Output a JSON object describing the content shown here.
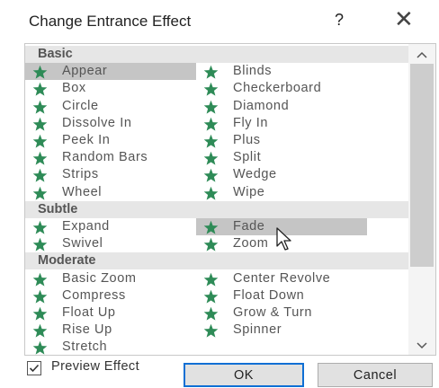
{
  "window": {
    "title": "Change Entrance Effect",
    "help_label": "?",
    "close_label": "✕"
  },
  "effects": {
    "sections": [
      {
        "name": "Basic",
        "items": [
          {
            "label": "Appear",
            "selected": true
          },
          {
            "label": "Blinds",
            "selected": false
          },
          {
            "label": "Box",
            "selected": false
          },
          {
            "label": "Checkerboard",
            "selected": false
          },
          {
            "label": "Circle",
            "selected": false
          },
          {
            "label": "Diamond",
            "selected": false
          },
          {
            "label": "Dissolve In",
            "selected": false
          },
          {
            "label": "Fly In",
            "selected": false
          },
          {
            "label": "Peek In",
            "selected": false
          },
          {
            "label": "Plus",
            "selected": false
          },
          {
            "label": "Random Bars",
            "selected": false
          },
          {
            "label": "Split",
            "selected": false
          },
          {
            "label": "Strips",
            "selected": false
          },
          {
            "label": "Wedge",
            "selected": false
          },
          {
            "label": "Wheel",
            "selected": false
          },
          {
            "label": "Wipe",
            "selected": false
          }
        ]
      },
      {
        "name": "Subtle",
        "items": [
          {
            "label": "Expand",
            "selected": false
          },
          {
            "label": "Fade",
            "selected": true
          },
          {
            "label": "Swivel",
            "selected": false
          },
          {
            "label": "Zoom",
            "selected": false
          }
        ]
      },
      {
        "name": "Moderate",
        "items": [
          {
            "label": "Basic Zoom",
            "selected": false
          },
          {
            "label": "Center Revolve",
            "selected": false
          },
          {
            "label": "Compress",
            "selected": false
          },
          {
            "label": "Float Down",
            "selected": false
          },
          {
            "label": "Float Up",
            "selected": false
          },
          {
            "label": "Grow & Turn",
            "selected": false
          },
          {
            "label": "Rise Up",
            "selected": false
          },
          {
            "label": "Spinner",
            "selected": false
          },
          {
            "label": "Stretch",
            "selected": false
          }
        ]
      }
    ],
    "star_icon": "star-icon",
    "star_color": "#2e8b57"
  },
  "scrollbar": {
    "up_icon": "chevron-up-icon",
    "down_icon": "chevron-down-icon",
    "up_glyph": "^",
    "down_glyph": "v"
  },
  "footer": {
    "preview_checkbox_checked": true,
    "preview_label": "Preview Effect",
    "ok_label": "OK",
    "cancel_label": "Cancel"
  },
  "colors": {
    "selected_bg": "#c5c5c5",
    "section_bg": "#e6e6e6",
    "focus_border": "#0f6fd4"
  }
}
